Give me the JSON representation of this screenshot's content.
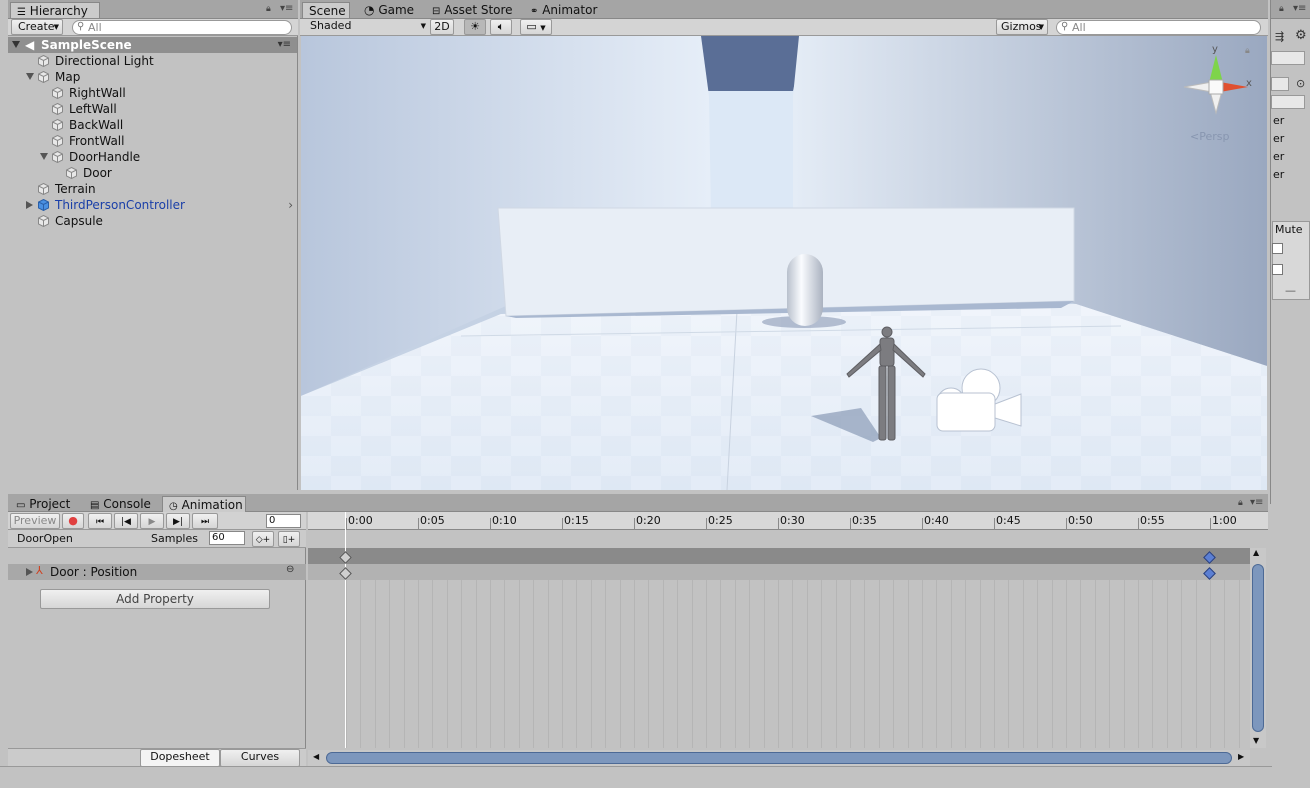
{
  "hierarchy": {
    "tab_label": "Hierarchy",
    "create_label": "Create",
    "search_placeholder": "All",
    "scene_name": "SampleScene",
    "items": [
      {
        "label": "Directional Light"
      },
      {
        "label": "Map"
      },
      {
        "label": "RightWall"
      },
      {
        "label": "LeftWall"
      },
      {
        "label": "BackWall"
      },
      {
        "label": "FrontWall"
      },
      {
        "label": "DoorHandle"
      },
      {
        "label": "Door"
      },
      {
        "label": "Terrain"
      },
      {
        "label": "ThirdPersonController"
      },
      {
        "label": "Capsule"
      }
    ]
  },
  "scene_view": {
    "tabs": [
      {
        "label": "Scene",
        "icon": "grid-icon"
      },
      {
        "label": "Game",
        "icon": "pacman-icon"
      },
      {
        "label": "Asset Store",
        "icon": "store-icon"
      },
      {
        "label": "Animator",
        "icon": "animator-icon"
      }
    ],
    "shading_mode": "Shaded",
    "toggle_2d": "2D",
    "gizmos_label": "Gizmos",
    "search_placeholder": "All",
    "gizmo": {
      "y_axis": "y",
      "x_axis": "x",
      "projection": "Persp"
    }
  },
  "inspector_fragment": {
    "rows": [
      "er",
      "er",
      "er",
      "er"
    ],
    "mute_label": "Mute"
  },
  "bottom_panel": {
    "tabs": [
      {
        "label": "Project",
        "icon": "folder-icon"
      },
      {
        "label": "Console",
        "icon": "console-icon"
      },
      {
        "label": "Animation",
        "icon": "clock-icon"
      }
    ]
  },
  "animation": {
    "preview_label": "Preview",
    "frame_value": "0",
    "clip_name": "DoorOpen",
    "samples_label": "Samples",
    "samples_value": "60",
    "property_label": "Door : Position",
    "add_property_label": "Add Property",
    "dopesheet_label": "Dopesheet",
    "curves_label": "Curves",
    "timeline_ticks": [
      "0:00",
      "0:05",
      "0:10",
      "0:15",
      "0:20",
      "0:25",
      "0:30",
      "0:35",
      "0:40",
      "0:45",
      "0:50",
      "0:55",
      "1:00"
    ],
    "keyframes_at": [
      "0:00",
      "1:00"
    ]
  },
  "colors": {
    "selected_blue": "#1a3fa8",
    "keyframe_blue": "#5b7fd3",
    "record_red": "#e04040"
  }
}
